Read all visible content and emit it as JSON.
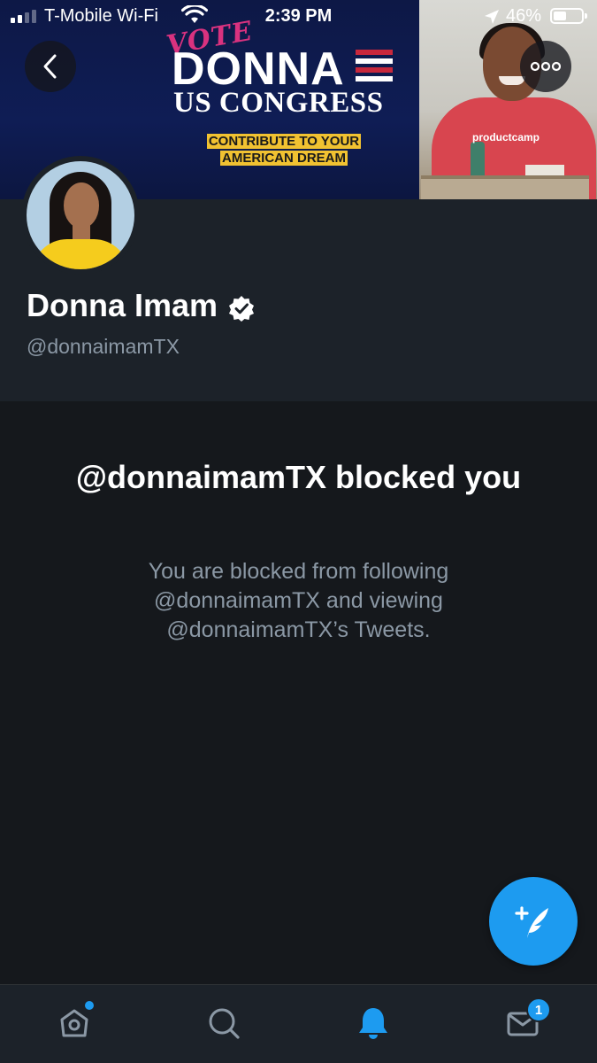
{
  "status_bar": {
    "carrier": "T-Mobile Wi-Fi",
    "time": "2:39 PM",
    "battery_percent": "46%",
    "battery_level": 0.46
  },
  "banner": {
    "vote_text": "VOTE",
    "name_text": "DONNA",
    "subtitle_text": "US CONGRESS",
    "tagline_line1": "CONTRIBUTE TO YOUR",
    "tagline_line2": "AMERICAN DREAM",
    "photo_logo_text": "productcamp"
  },
  "profile": {
    "display_name": "Donna Imam",
    "handle": "@donnaimamTX",
    "verified": true
  },
  "blocked_notice": {
    "title": "@donnaimamTX blocked you",
    "body": "You are blocked from following @donnaimamTX and viewing @donnaimamTX’s Tweets."
  },
  "tab_bar": {
    "items": [
      {
        "name": "home",
        "icon": "home-icon",
        "has_dot": true
      },
      {
        "name": "search",
        "icon": "search-icon"
      },
      {
        "name": "notifications",
        "icon": "bell-icon",
        "active": true
      },
      {
        "name": "messages",
        "icon": "mail-icon",
        "badge": "1"
      }
    ]
  },
  "colors": {
    "accent": "#1d9bf0",
    "background": "#15181c",
    "header_background": "#1c2229",
    "secondary_text": "#8b98a5"
  }
}
